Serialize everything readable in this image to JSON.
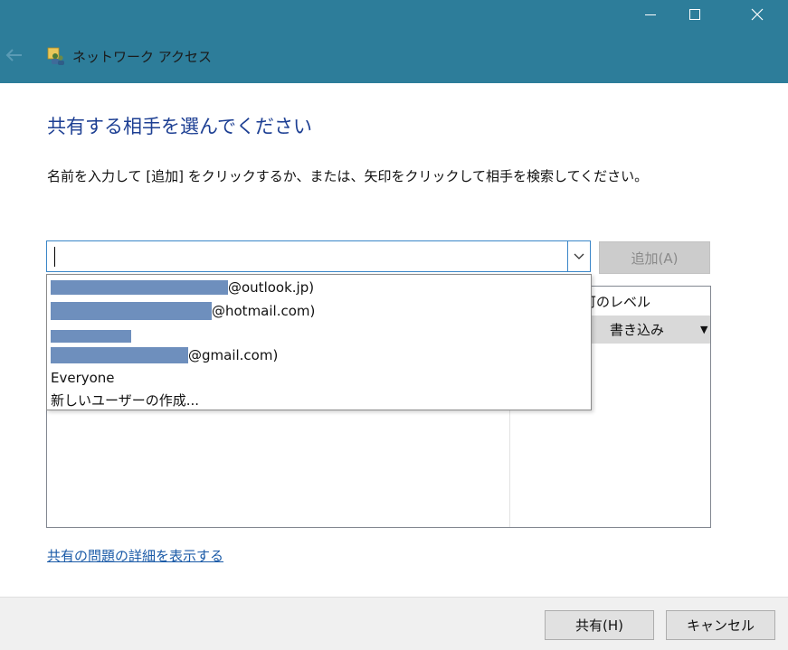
{
  "window": {
    "title": "ネットワーク アクセス",
    "buttons": {
      "minimize": "minimize-icon",
      "maximize": "maximize-icon",
      "close": "close-icon"
    },
    "titlebar_color": "#2d7d9a"
  },
  "heading": "共有する相手を選んでください",
  "instructions": "名前を入力して [追加] をクリックするか、または、矢印をクリックして相手を検索してください。",
  "combo": {
    "value": ""
  },
  "add_button": "追加(A)",
  "table": {
    "col_header_permission": "可のレベル",
    "row_permission": "書き込み"
  },
  "dropdown": {
    "items": [
      {
        "suffix": "@outlook.jp)"
      },
      {
        "suffix": "@hotmail.com)"
      },
      {
        "suffix": ""
      },
      {
        "suffix": "@gmail.com)"
      },
      {
        "label": "Everyone"
      },
      {
        "label": "新しいユーザーの作成..."
      }
    ]
  },
  "link": "共有の問題の詳細を表示する",
  "footer": {
    "share_button": "共有(H)",
    "cancel_button": "キャンセル"
  }
}
